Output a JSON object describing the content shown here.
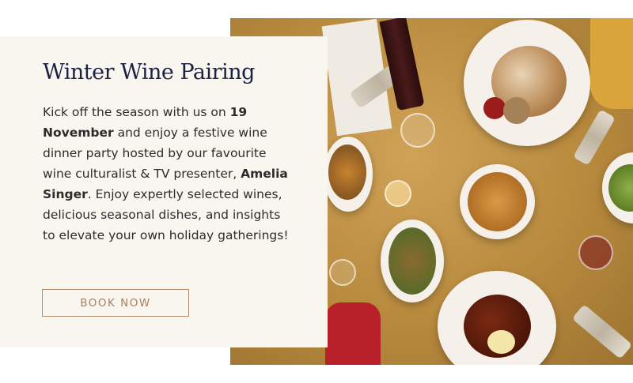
{
  "promo": {
    "title": "Winter Wine Pairing",
    "description": {
      "t1": "Kick off the season with us on ",
      "b1": "19 November",
      "t2": " and enjoy a festive wine dinner party hosted by our favourite wine culturalist & TV presenter, ",
      "b2": "Amelia Singer",
      "t3": ". Enjoy expertly selected wines, delicious seasonal dishes, and insights to elevate your own holiday gatherings!"
    },
    "cta_label": "BOOK NOW"
  },
  "colors": {
    "title": "#1b2140",
    "card_background": "#f9f6f0",
    "cta_border": "#b48a6e",
    "cta_text": "#a9805f"
  }
}
